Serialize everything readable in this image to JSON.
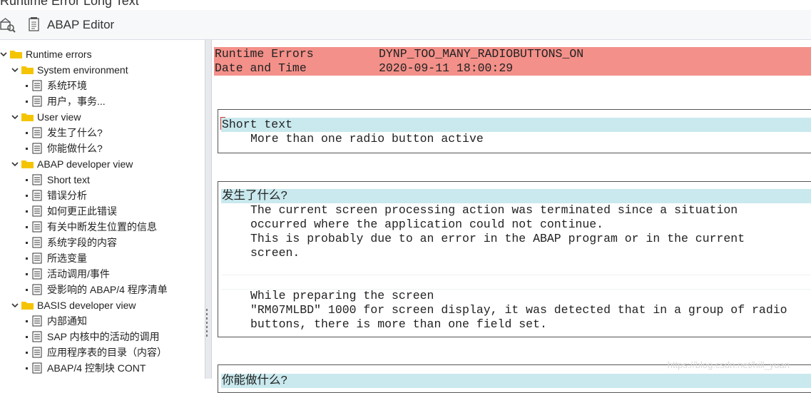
{
  "window": {
    "title": "Runtime Error Long Text"
  },
  "toolbar": {
    "abap_editor_label": "ABAP Editor"
  },
  "tree": {
    "root": "Runtime errors",
    "groups": [
      {
        "label": "System environment",
        "items": [
          "系统环境",
          "用户，事务..."
        ]
      },
      {
        "label": "User view",
        "items": [
          "发生了什么?",
          "你能做什么?"
        ]
      },
      {
        "label": "ABAP developer view",
        "items": [
          "Short text",
          "错误分析",
          "如何更正此错误",
          "有关中断发生位置的信息",
          "系统字段的内容",
          "所选变量",
          "活动调用/事件",
          "受影响的 ABAP/4 程序清单"
        ]
      },
      {
        "label": "BASIS developer view",
        "items": [
          "内部通知",
          "SAP 内核中的活动的调用",
          "应用程序表的目录（内容）",
          "ABAP/4 控制块 CONT"
        ]
      }
    ]
  },
  "content": {
    "header": [
      {
        "key": "Runtime Errors",
        "value": "DYNP_TOO_MANY_RADIOBUTTONS_ON"
      },
      {
        "key": "Date and Time",
        "value": "2020-09-11 18:00:29"
      }
    ],
    "short_text": {
      "title": "Short text",
      "line": "More than one radio button active"
    },
    "what_happened": {
      "title": "发生了什么?",
      "lines": [
        "The current screen processing action was terminated since a situation",
        "occurred where the application could not continue.",
        "This is probably due to an error in the ABAP program or in the current",
        "screen.",
        "",
        "",
        "While preparing the screen",
        "\"RM07MLBD\" 1000 for screen display, it was detected that in a group of radio",
        "buttons, there is more than one field set."
      ]
    },
    "what_can_you_do": {
      "title": "你能做什么?"
    },
    "watermark": "https://blog.csdn.net/hill_yuan"
  },
  "colors": {
    "header_bg": "#f39089",
    "section_title_bg": "#c9e9ee",
    "folder": "#f5c400"
  }
}
